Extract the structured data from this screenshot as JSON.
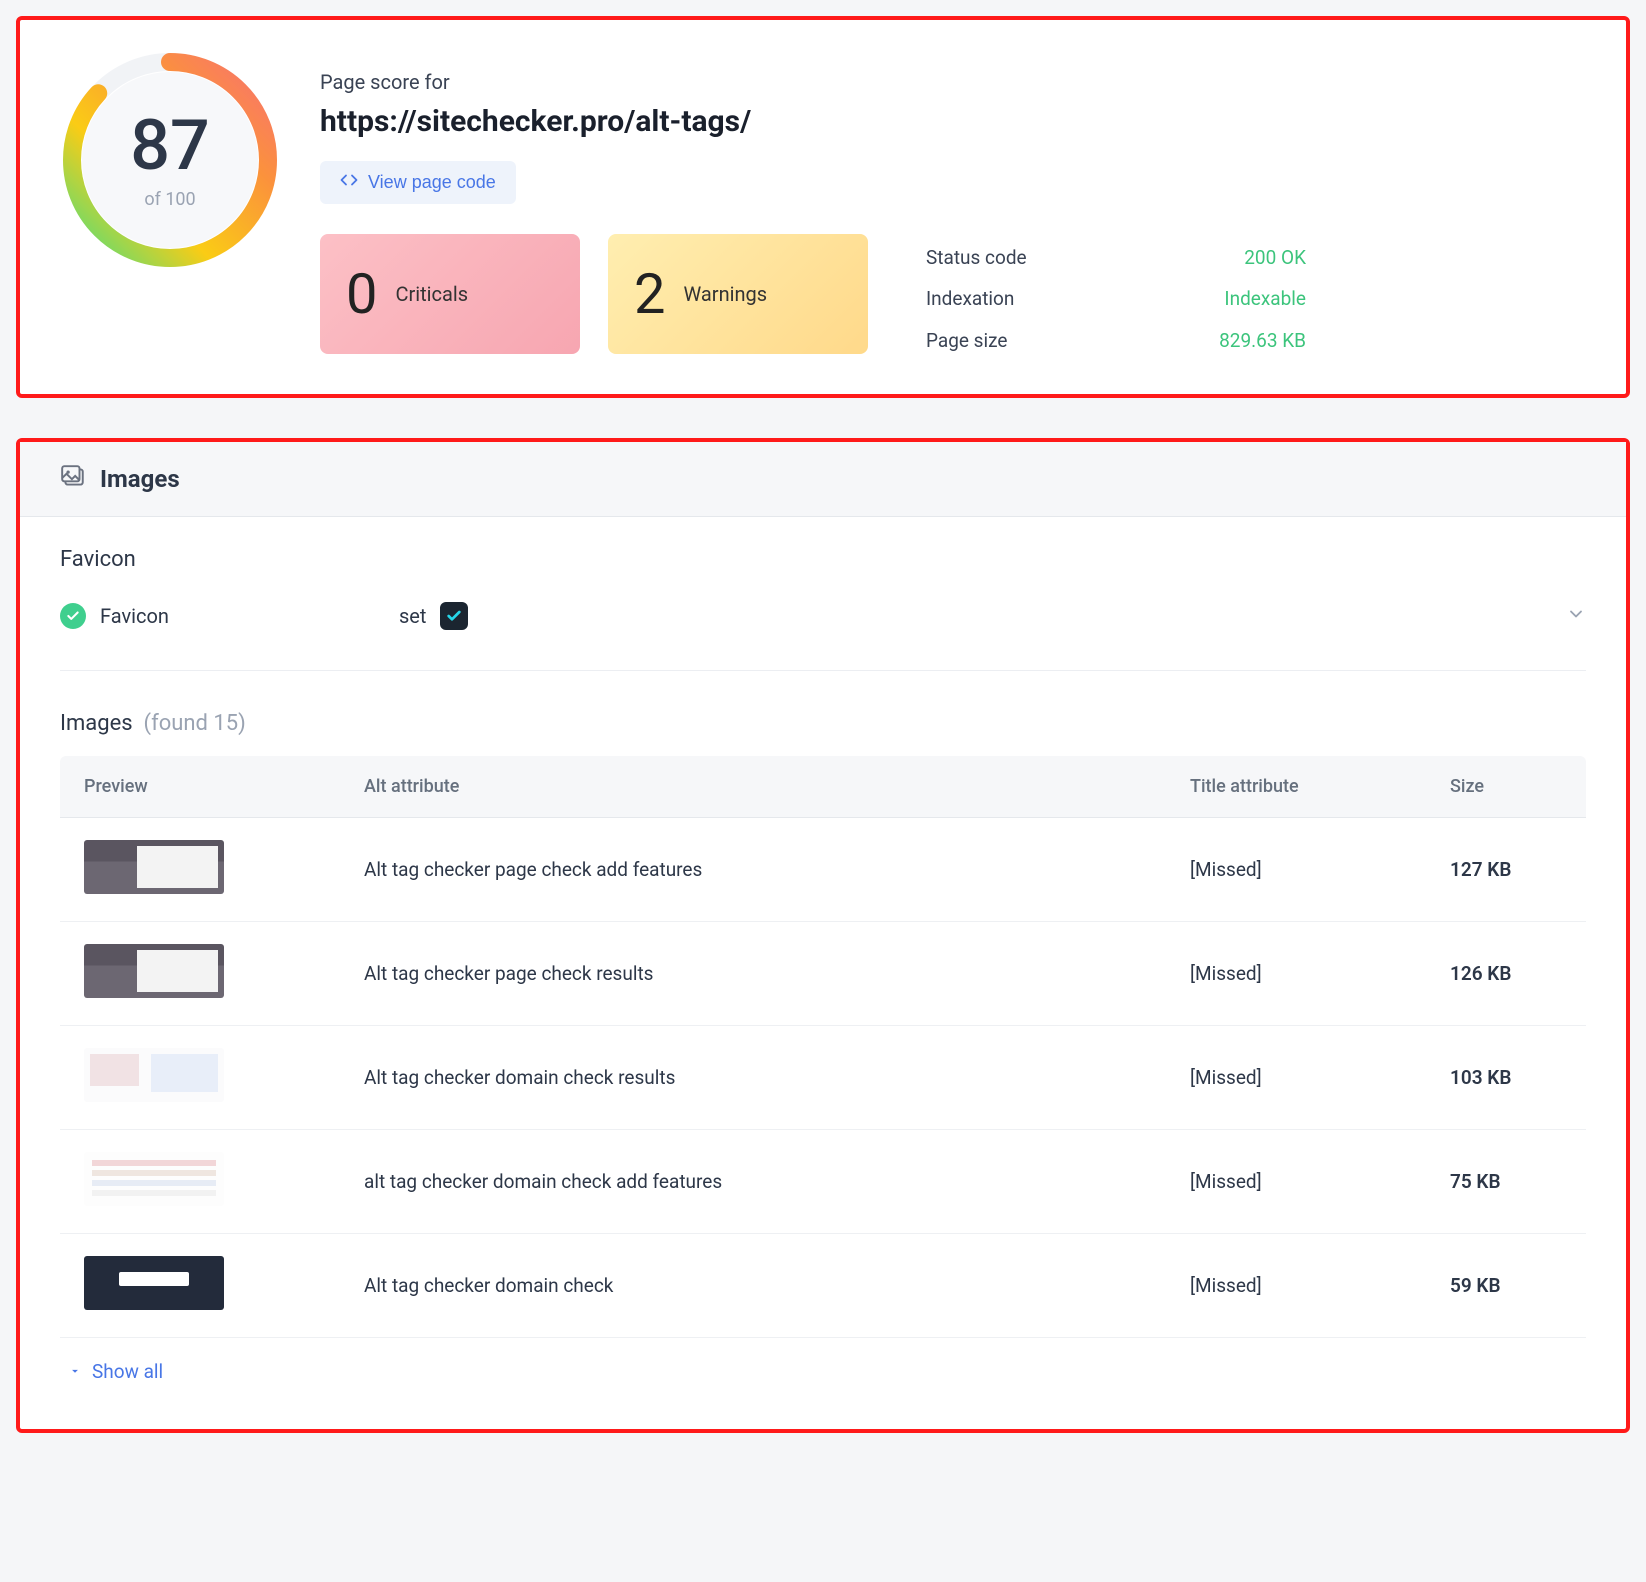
{
  "score": {
    "value": "87",
    "of_label": "of 100",
    "page_score_for": "Page score for",
    "url": "https://sitechecker.pro/alt-tags/",
    "view_code_label": "View page code",
    "criticals": {
      "count": "0",
      "label": "Criticals"
    },
    "warnings": {
      "count": "2",
      "label": "Warnings"
    },
    "stats": {
      "status_code_label": "Status code",
      "status_code_value": "200 OK",
      "indexation_label": "Indexation",
      "indexation_value": "Indexable",
      "page_size_label": "Page size",
      "page_size_value": "829.63 KB"
    }
  },
  "images_section": {
    "title": "Images",
    "favicon": {
      "heading": "Favicon",
      "row_label": "Favicon",
      "status_text": "set"
    },
    "images_heading": "Images",
    "found_label": "(found 15)",
    "columns": {
      "preview": "Preview",
      "alt": "Alt attribute",
      "title": "Title attribute",
      "size": "Size"
    },
    "rows": [
      {
        "alt": "Alt tag checker page check add features",
        "title": "[Missed]",
        "size": "127 KB",
        "thumb": "dark"
      },
      {
        "alt": "Alt tag checker page check results",
        "title": "[Missed]",
        "size": "126 KB",
        "thumb": "dark"
      },
      {
        "alt": "Alt tag checker domain check results",
        "title": "[Missed]",
        "size": "103 KB",
        "thumb": "light"
      },
      {
        "alt": "alt tag checker domain check add features",
        "title": "[Missed]",
        "size": "75 KB",
        "thumb": "list"
      },
      {
        "alt": "Alt tag checker domain check",
        "title": "[Missed]",
        "size": "59 KB",
        "thumb": "hero"
      }
    ],
    "show_all": "Show all"
  }
}
